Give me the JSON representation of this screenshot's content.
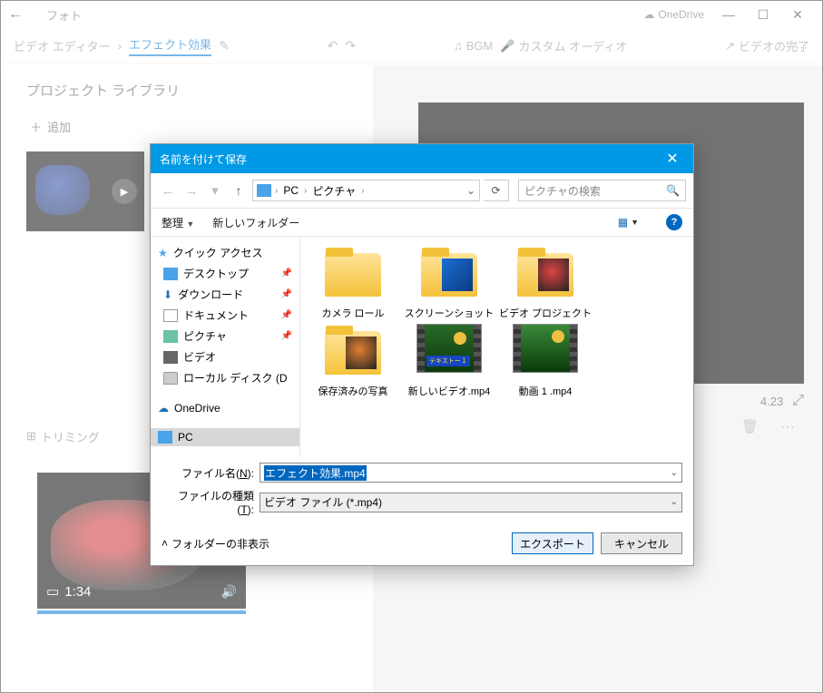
{
  "window": {
    "title": "フォト",
    "onedrive": "OneDrive"
  },
  "toolbar": {
    "video_editor": "ビデオ エディター",
    "effects": "エフェクト効果",
    "bgm": "BGM",
    "custom_audio": "カスタム オーディオ",
    "finish": "ビデオの完了"
  },
  "library": {
    "title": "プロジェクト ライブラリ",
    "add": "追加"
  },
  "preview": {
    "time": "4.23"
  },
  "timeline": {
    "trimming": "トリミング",
    "clip_duration": "1:34"
  },
  "dialog": {
    "title": "名前を付けて保存",
    "breadcrumb": {
      "pc": "PC",
      "pictures": "ピクチャ"
    },
    "search_placeholder": "ピクチャの検索",
    "organize": "整理",
    "new_folder": "新しいフォルダー",
    "tree": {
      "quick_access": "クイック アクセス",
      "desktop": "デスクトップ",
      "downloads": "ダウンロード",
      "documents": "ドキュメント",
      "pictures": "ピクチャ",
      "videos": "ビデオ",
      "local_disk": "ローカル ディスク (D",
      "onedrive": "OneDrive",
      "pc": "PC"
    },
    "files": {
      "camera_roll": "カメラ ロール",
      "screenshots": "スクリーンショット",
      "video_project": "ビデオ プロジェクト",
      "saved_pictures": "保存済みの写真",
      "new_video": "新しいビデオ.mp4",
      "video1": "動画 1 .mp4",
      "text_overlay": "テキストー１"
    },
    "filename_label": "ファイル名(N):",
    "filetype_label": "ファイルの種類(T):",
    "filename_value": "エフェクト効果.mp4",
    "filetype_value": "ビデオ ファイル (*.mp4)",
    "hide_folders": "フォルダーの非表示",
    "export": "エクスポート",
    "cancel": "キャンセル"
  }
}
